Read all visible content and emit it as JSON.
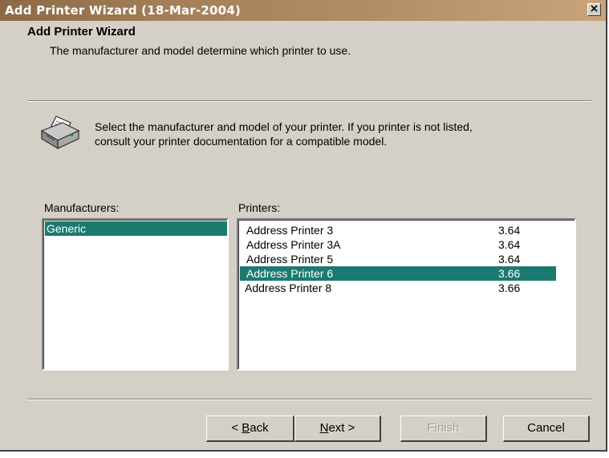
{
  "window": {
    "title": "Add Printer Wizard (18-Mar-2004)",
    "close_label": "×"
  },
  "header": {
    "title": "Add Printer Wizard",
    "subtitle": "The manufacturer and model determine which printer to use."
  },
  "instructions": {
    "line1": "Select the manufacturer and model of your printer. If you printer is not listed,",
    "line2": "consult your printer documentation for a compatible model."
  },
  "manufacturers": {
    "label": "Manufacturers:",
    "items": [
      {
        "name": "Generic",
        "selected": true
      }
    ]
  },
  "printers": {
    "label": "Printers:",
    "items": [
      {
        "name": "Address Printer 3",
        "version": "3.64",
        "selected": false
      },
      {
        "name": "Address Printer 3A",
        "version": "3.64",
        "selected": false
      },
      {
        "name": "Address Printer 5",
        "version": "3.64",
        "selected": false
      },
      {
        "name": "Address Printer 6",
        "version": "3.66",
        "selected": true
      },
      {
        "name": "Address Printer 8",
        "version": "3.66",
        "selected": false
      }
    ]
  },
  "buttons": {
    "back_mnemonic": "B",
    "back_rest": "ack",
    "back_prefix": "< ",
    "next_mnemonic": "N",
    "next_rest": "ext >",
    "finish": "Finish",
    "cancel": "Cancel",
    "finish_enabled": false
  },
  "colors": {
    "selection": "#1b7a70",
    "dialog_face": "#d4d0c8",
    "titlebar": "#a58058"
  },
  "icons": {
    "wizard": "printer-icon",
    "close": "close-icon"
  }
}
